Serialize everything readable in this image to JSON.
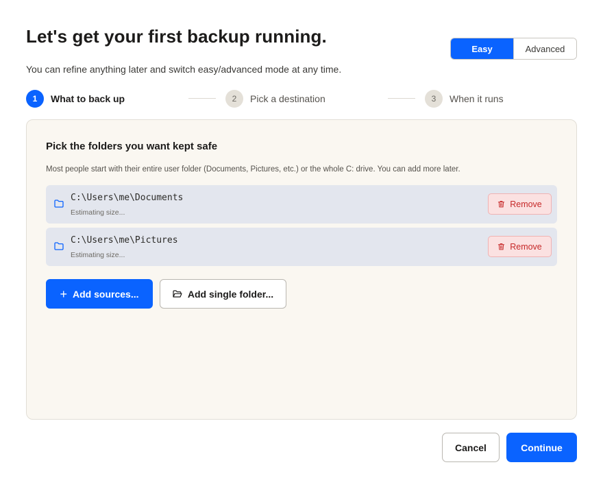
{
  "header": {
    "title": "Let's get your first backup running.",
    "subtitle": "You can refine anything later and switch easy/advanced mode at any time."
  },
  "mode_toggle": {
    "options": [
      {
        "label": "Easy",
        "active": true
      },
      {
        "label": "Advanced",
        "active": false
      }
    ]
  },
  "stepper": {
    "steps": [
      {
        "num": "1",
        "label": "What to back up",
        "active": true
      },
      {
        "num": "2",
        "label": "Pick a destination",
        "active": false
      },
      {
        "num": "3",
        "label": "When it runs",
        "active": false
      }
    ]
  },
  "panel": {
    "title": "Pick the folders you want kept safe",
    "description": "Most people start with their entire user folder (Documents, Pictures, etc.) or the whole C: drive. You can add more later.",
    "folders": [
      {
        "path": "C:\\Users\\me\\Documents",
        "size": "Estimating size...",
        "remove_label": "Remove",
        "icon": "folder-icon"
      },
      {
        "path": "C:\\Users\\me\\Pictures",
        "size": "Estimating size...",
        "remove_label": "Remove",
        "icon": "folder-icon"
      }
    ],
    "add_sources_label": "Add sources...",
    "add_single_folder_label": "Add single folder..."
  },
  "footer": {
    "cancel_label": "Cancel",
    "continue_label": "Continue"
  },
  "colors": {
    "accent": "#0a63ff",
    "panel_bg": "#faf7f1",
    "row_bg": "#e3e6ee",
    "danger": "#c62828",
    "danger_bg": "#fbe1e1"
  }
}
